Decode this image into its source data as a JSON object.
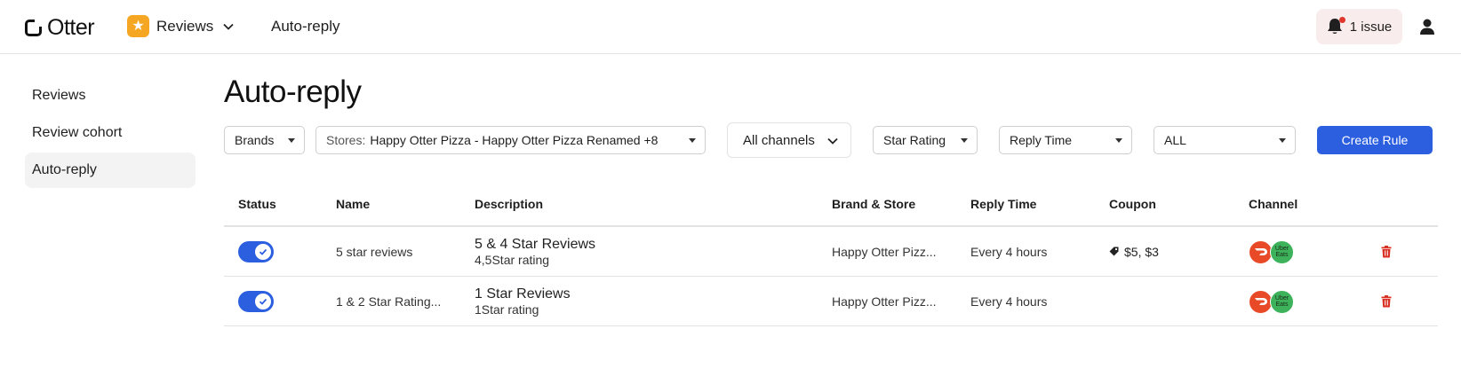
{
  "header": {
    "logo_text": "Otter",
    "product_label": "Reviews",
    "breadcrumb": "Auto-reply",
    "issue_label": "1 issue",
    "accent_color": "#2c5fe0",
    "product_icon_color": "#f5a623"
  },
  "sidebar": {
    "items": [
      {
        "label": "Reviews",
        "active": false
      },
      {
        "label": "Review cohort",
        "active": false
      },
      {
        "label": "Auto-reply",
        "active": true
      }
    ]
  },
  "page": {
    "title": "Auto-reply"
  },
  "filters": {
    "brands": "Brands",
    "stores_prefix": "Stores:",
    "stores_value": "Happy Otter Pizza - Happy Otter Pizza Renamed +8",
    "channels": "All channels",
    "star_rating": "Star Rating",
    "reply_time": "Reply Time",
    "all": "ALL",
    "create_rule": "Create Rule"
  },
  "table": {
    "columns": [
      "Status",
      "Name",
      "Description",
      "Brand & Store",
      "Reply Time",
      "Coupon",
      "Channel"
    ],
    "rows": [
      {
        "status": "on",
        "name": "5 star reviews",
        "desc_title": "5 & 4 Star Reviews",
        "desc_sub": "4,5Star rating",
        "brand_store": "Happy Otter Pizz...",
        "reply_time": "Every 4 hours",
        "coupon": "$5, $3",
        "channels": [
          "doordash",
          "uber-eats"
        ]
      },
      {
        "status": "on",
        "name": "1 & 2 Star Rating...",
        "desc_title": "1 Star Reviews",
        "desc_sub": "1Star rating",
        "brand_store": "Happy Otter Pizz...",
        "reply_time": "Every 4 hours",
        "coupon": "",
        "channels": [
          "doordash",
          "uber-eats"
        ]
      }
    ]
  },
  "channel_labels": {
    "uber_eats": "Uber Eats"
  },
  "colors": {
    "doordash": "#e84a27",
    "uber_eats": "#3db25a",
    "delete": "#d93025",
    "issue_bg": "#f9ecec"
  }
}
